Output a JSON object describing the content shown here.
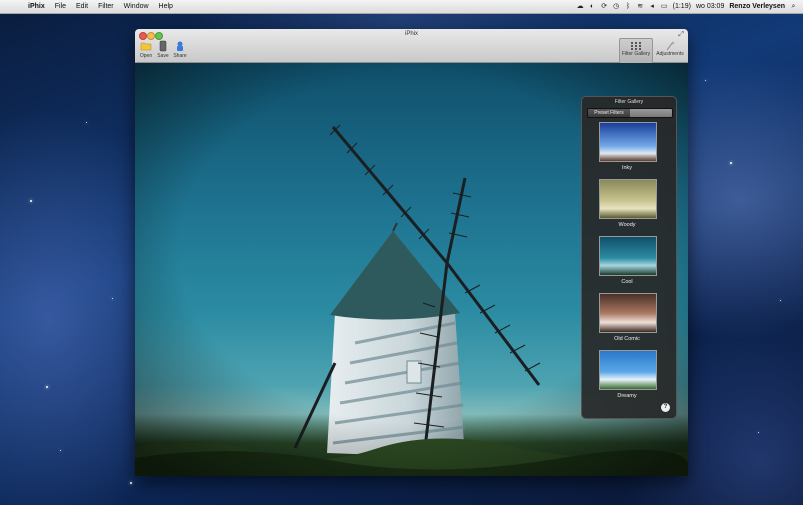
{
  "menubar": {
    "app_name": "iPhix",
    "menus": [
      "File",
      "Edit",
      "Filter",
      "Window",
      "Help"
    ],
    "clock": "wo 03:09",
    "battery_time": "(1:19)",
    "user": "Renzo Verleysen"
  },
  "window": {
    "title": "iPhix",
    "toolbar": {
      "open_label": "Open",
      "save_label": "Save",
      "share_label": "Share",
      "filter_gallery_label": "Filter Gallery",
      "adjustments_label": "Adjustments"
    }
  },
  "gallery": {
    "title": "Filter Gallery",
    "tabs": [
      "Preset Filters",
      ""
    ],
    "presets": [
      {
        "label": "Inky"
      },
      {
        "label": "Woody"
      },
      {
        "label": "Cool"
      },
      {
        "label": "Old Comic"
      },
      {
        "label": "Dreamy"
      }
    ],
    "help": "?"
  }
}
